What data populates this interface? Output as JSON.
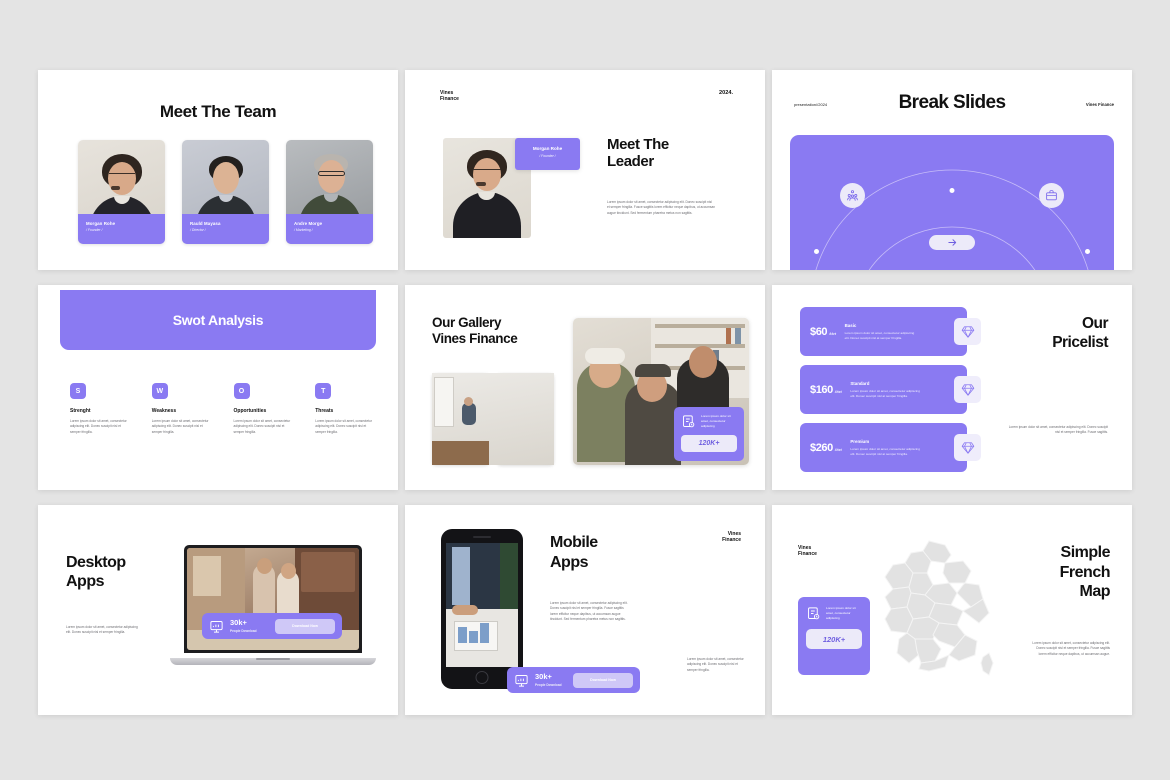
{
  "theme": {
    "accent": "#8a7af2",
    "accent_light": "#eceaf9",
    "background": "#e4e4e4",
    "slide_bg": "#ffffff",
    "text": "#111111"
  },
  "lorem": {
    "short": "Lorem ipsum dolor sit amet, consectetur adipiscing elit. Donec suscipit nisl et semper fringilla.",
    "medium": "Lorem ipsum dolor sit amet, consectetur adipiscing elit. Donec suscipit nisl et semper fringilla. Fusce sagittis lorem efficitur neque dapibus, ut accumsan augue tincidunt. Sed fermentum pharetra metus non sagittis.",
    "price": "Lorem ipsum dolor sit amet, consectetur adipiscing elit. Donec suscipit nisl at semper fringilla.",
    "pricelist_side": "Lorem ipsum dolor sit amet, consectetur adipiscing elit. Donec suscipit nisl et semper fringilla. Fusce sagittis.",
    "map_side": "Lorem ipsum dolor sit amet, consectetur adipiscing elit. Donec suscipit nisl et semper fringilla. Fusce sagittis lorem efficitur neque dapibus, ut accumsan augue.",
    "card": "Lorem ipsum dolor sit amet, consectetur adipiscing",
    "mobile_side": "Lorem ipsum dolor sit amet, consectetur adipiscing elit. Donec suscipit nisl et semper fringilla."
  },
  "slides": [
    {
      "id": "meet-the-team",
      "title": "Meet The Team",
      "members": [
        {
          "name": "Morgan Rohe",
          "role": "/ Founder /"
        },
        {
          "name": "Rauld Mayasa",
          "role": "/ Director /"
        },
        {
          "name": "Andre Morge",
          "role": "/ Marketing /"
        }
      ]
    },
    {
      "id": "meet-the-leader",
      "brand": "Vines\nFinance",
      "brand_line1": "Vines",
      "brand_line2": "Finance",
      "year": "2024.",
      "title_line1": "Meet The",
      "title_line2": "Leader",
      "badge_name": "Morgan Rohe",
      "badge_role": "/ Founder /"
    },
    {
      "id": "break-slides",
      "left_label": "presentation//2024",
      "title": "Break Slides",
      "right_label": "Vines Finance",
      "icons": [
        "people-group-icon",
        "briefcase-icon"
      ],
      "button_icon": "arrow-right-icon"
    },
    {
      "id": "swot-analysis",
      "title": "Swot Analysis",
      "items": [
        {
          "letter": "S",
          "heading": "Strenght"
        },
        {
          "letter": "W",
          "heading": "Weakness"
        },
        {
          "letter": "O",
          "heading": "Opportunities"
        },
        {
          "letter": "T",
          "heading": "Threats"
        }
      ]
    },
    {
      "id": "our-gallery",
      "title_line1": "Our Gallery",
      "title_line2": "Vines Finance",
      "overlay_kpi": "120K+",
      "overlay_icon": "document-chart-icon"
    },
    {
      "id": "our-pricelist",
      "title_line1": "Our",
      "title_line2": "Pricelist",
      "plans": [
        {
          "price": "$60",
          "period": "/Mont",
          "name": "Basic"
        },
        {
          "price": "$160",
          "period": "/Mont",
          "name": "Standard"
        },
        {
          "price": "$260",
          "period": "/Mont",
          "name": "Premium"
        }
      ],
      "gem_icon": "diamond-icon"
    },
    {
      "id": "desktop-apps",
      "title_line1": "Desktop",
      "title_line2": "Apps",
      "badge_count": "30k+",
      "badge_sub": "People Download",
      "badge_button": "Download Now",
      "badge_icon": "monitor-chart-icon"
    },
    {
      "id": "mobile-apps",
      "title_line1": "Mobile",
      "title_line2": "Apps",
      "brand_line1": "Vines",
      "brand_line2": "Finance",
      "badge_count": "30k+",
      "badge_sub": "People Download",
      "badge_button": "Download Now",
      "badge_icon": "monitor-chart-icon"
    },
    {
      "id": "simple-french-map",
      "brand_line1": "Vines",
      "brand_line2": "Finance",
      "title_line1": "Simple",
      "title_line2": "French",
      "title_line3": "Map",
      "card_kpi": "120K+",
      "card_icon": "document-chart-icon"
    }
  ]
}
